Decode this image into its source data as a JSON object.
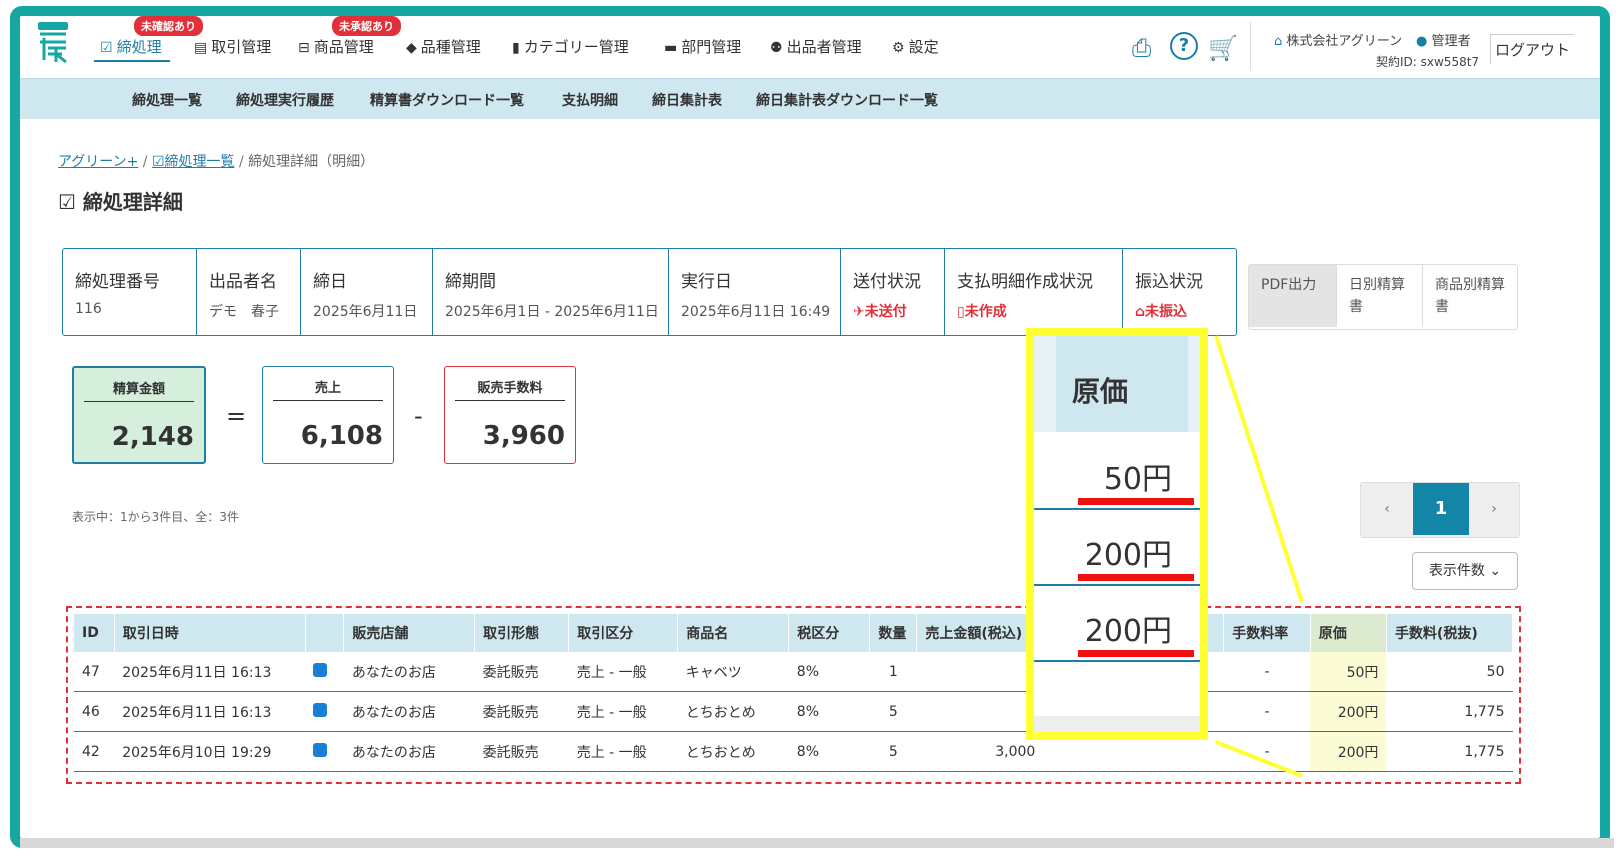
{
  "nav": {
    "items": [
      {
        "label": "締処理",
        "icon": "check-icon",
        "badge": "未確認あり"
      },
      {
        "label": "取引管理",
        "icon": "list-icon"
      },
      {
        "label": "商品管理",
        "icon": "basket-icon",
        "badge": "未承認あり"
      },
      {
        "label": "品種管理",
        "icon": "tag-icon"
      },
      {
        "label": "カテゴリー管理",
        "icon": "bookmark-icon"
      },
      {
        "label": "部門管理",
        "icon": "folder-icon"
      },
      {
        "label": "出品者管理",
        "icon": "users-icon"
      },
      {
        "label": "設定",
        "icon": "gear-icon"
      }
    ],
    "company": "株式会社アグリーン",
    "role": "管理者",
    "contract": "契約ID: sxw558t7",
    "logout": "ログアウト"
  },
  "subnav": [
    "締処理一覧",
    "締処理実行履歴",
    "精算書ダウンロード一覧",
    "支払明細",
    "締日集計表",
    "締日集計表ダウンロード一覧"
  ],
  "breadcrumb": {
    "home": "アグリーン+",
    "list": "締処理一覧",
    "current": "締処理詳細（明細）"
  },
  "title": "締処理詳細",
  "summary": {
    "number_label": "締処理番号",
    "number": "116",
    "seller_label": "出品者名",
    "seller": "デモ　春子",
    "closing_label": "締日",
    "closing": "2025年6月11日",
    "period_label": "締期間",
    "period": "2025年6月1日 - 2025年6月11日",
    "exec_label": "実行日",
    "exec": "2025年6月11日 16:49",
    "send_label": "送付状況",
    "send": "未送付",
    "statement_label": "支払明細作成状況",
    "statement": "未作成",
    "transfer_label": "振込状況",
    "transfer": "未振込"
  },
  "buttons": {
    "pdf": "PDF出力",
    "daily": "日別精算書",
    "product": "商品別精算書"
  },
  "amounts": {
    "settle_label": "精算金額",
    "settle": "2,148",
    "sales_label": "売上",
    "sales": "6,108",
    "fee_label": "販売手数料",
    "fee": "3,960",
    "eq": "=",
    "minus": "-"
  },
  "showing": "表示中：1から3件目、全：3件",
  "pager": {
    "prev": "‹",
    "page": "1",
    "next": "›"
  },
  "perpage": "表示件数",
  "table": {
    "headers": [
      "ID",
      "取引日時",
      "",
      "販売店舗",
      "取引形態",
      "取引区分",
      "商品名",
      "税区分",
      "数量",
      "売上金額(税込)",
      "",
      "手数料率",
      "原価",
      "手数料(税抜)"
    ],
    "rows": [
      [
        "47",
        "2025年6月11日 16:13",
        "",
        "あなたのお店",
        "委託販売",
        "売上 - 一般",
        "キャベツ",
        "8%",
        "1",
        "",
        "",
        "-",
        "50円",
        "50"
      ],
      [
        "46",
        "2025年6月11日 16:13",
        "",
        "あなたのお店",
        "委託販売",
        "売上 - 一般",
        "とちおとめ",
        "8%",
        "5",
        "",
        "",
        "-",
        "200円",
        "1,775"
      ],
      [
        "42",
        "2025年6月10日 19:29",
        "",
        "あなたのお店",
        "委託販売",
        "売上 - 一般",
        "とちおとめ",
        "8%",
        "5",
        "3,000",
        "",
        "-",
        "200円",
        "1,775"
      ]
    ]
  },
  "zoom": {
    "header": "原価",
    "values": [
      "50円",
      "200円",
      "200円"
    ]
  },
  "colors": {
    "accent": "#1f7ea6",
    "frame": "#17a7a3",
    "alert": "#e0303a",
    "callout": "#ffff33"
  }
}
